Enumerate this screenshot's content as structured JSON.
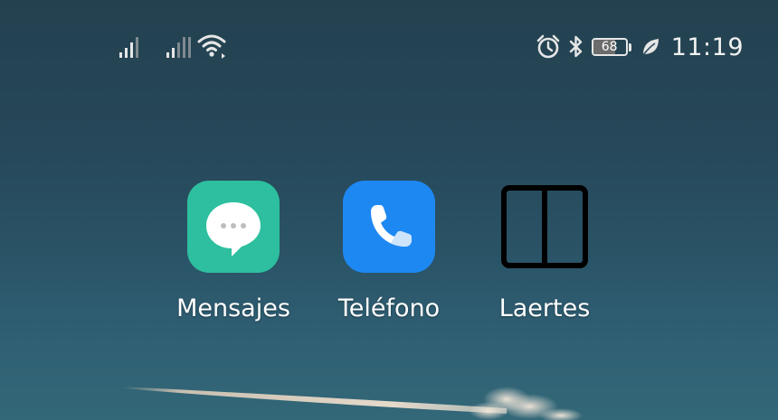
{
  "colors": {
    "status_icon": "#e6e6e6",
    "signal_dim": "#7f8a90",
    "messages_bg": "#2dbf9f",
    "phone_bg": "#1e88f2",
    "laertes_bg": "#000000"
  },
  "status_bar": {
    "signal_1": "signal-icon",
    "signal_2": "signal-icon",
    "wifi": "wifi-icon",
    "alarm": "alarm-icon",
    "bluetooth": "bluetooth-icon",
    "battery_level": 68,
    "battery_text": "68",
    "leaf": "leaf-icon",
    "time": "11:19"
  },
  "apps": [
    {
      "label": "Mensajes",
      "icon": "messages-icon"
    },
    {
      "label": "Teléfono",
      "icon": "phone-icon"
    },
    {
      "label": "Laertes",
      "icon": "laertes-icon"
    }
  ]
}
